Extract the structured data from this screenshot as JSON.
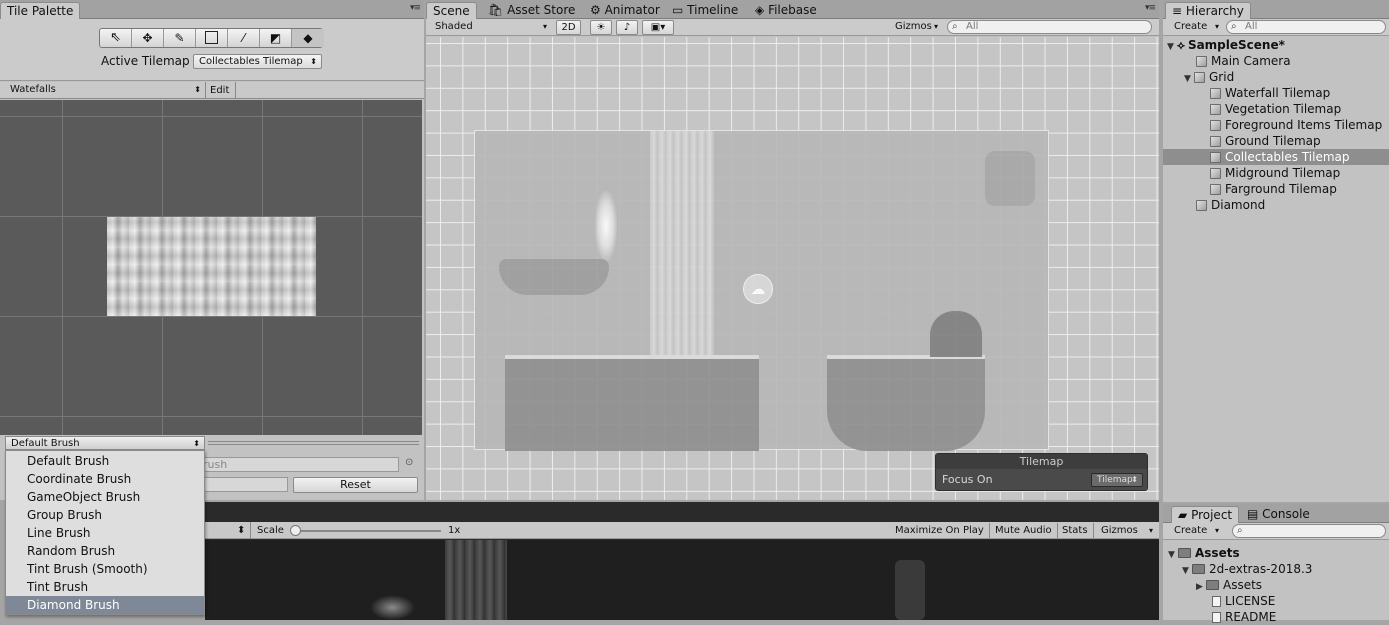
{
  "tile_palette": {
    "tab_label": "Tile Palette",
    "tools": [
      "select-icon",
      "move-icon",
      "paint-brush-icon",
      "box-fill-icon",
      "picker-icon",
      "eraser-icon",
      "fill-icon"
    ],
    "active_tilemap_label": "Active Tilemap",
    "active_tilemap_value": "Collectables Tilemap",
    "palette_value": "Watefalls",
    "edit_label": "Edit",
    "brush_value": "Default Brush",
    "brush_field_partial": "rush",
    "reset_label": "Reset",
    "brush_options": [
      "Default Brush",
      "Coordinate Brush",
      "GameObject Brush",
      "Group Brush",
      "Line Brush",
      "Random Brush",
      "Tint Brush (Smooth)",
      "Tint Brush",
      "Diamond Brush"
    ],
    "selected_brush": "Diamond Brush"
  },
  "scene": {
    "tabs": [
      "Scene",
      "Asset Store",
      "Animator",
      "Timeline",
      "Filebase"
    ],
    "shading_mode": "Shaded",
    "mode_2d": "2D",
    "gizmos_label": "Gizmos",
    "search_placeholder": "All",
    "overlay_title": "Tilemap",
    "overlay_focus_label": "Focus On",
    "overlay_focus_value": "Tilemap"
  },
  "game": {
    "scale_label": "Scale",
    "scale_value": "1x",
    "buttons": [
      "Maximize On Play",
      "Mute Audio",
      "Stats",
      "Gizmos"
    ]
  },
  "hierarchy": {
    "tab_label": "Hierarchy",
    "create_label": "Create",
    "search_placeholder": "All",
    "scene_name": "SampleScene*",
    "items": [
      {
        "label": "Main Camera",
        "depth": 1
      },
      {
        "label": "Grid",
        "depth": 1
      },
      {
        "label": "Waterfall Tilemap",
        "depth": 2
      },
      {
        "label": "Vegetation Tilemap",
        "depth": 2
      },
      {
        "label": "Foreground Items Tilemap",
        "depth": 2
      },
      {
        "label": "Ground Tilemap",
        "depth": 2
      },
      {
        "label": "Collectables Tilemap",
        "depth": 2
      },
      {
        "label": "Midground Tilemap",
        "depth": 2
      },
      {
        "label": "Farground Tilemap",
        "depth": 2
      },
      {
        "label": "Diamond",
        "depth": 1
      }
    ],
    "selected": "Collectables Tilemap"
  },
  "project": {
    "tabs": [
      "Project",
      "Console"
    ],
    "create_label": "Create",
    "items": [
      "Assets",
      "2d-extras-2018.3",
      "Assets",
      "LICENSE",
      "README"
    ]
  }
}
